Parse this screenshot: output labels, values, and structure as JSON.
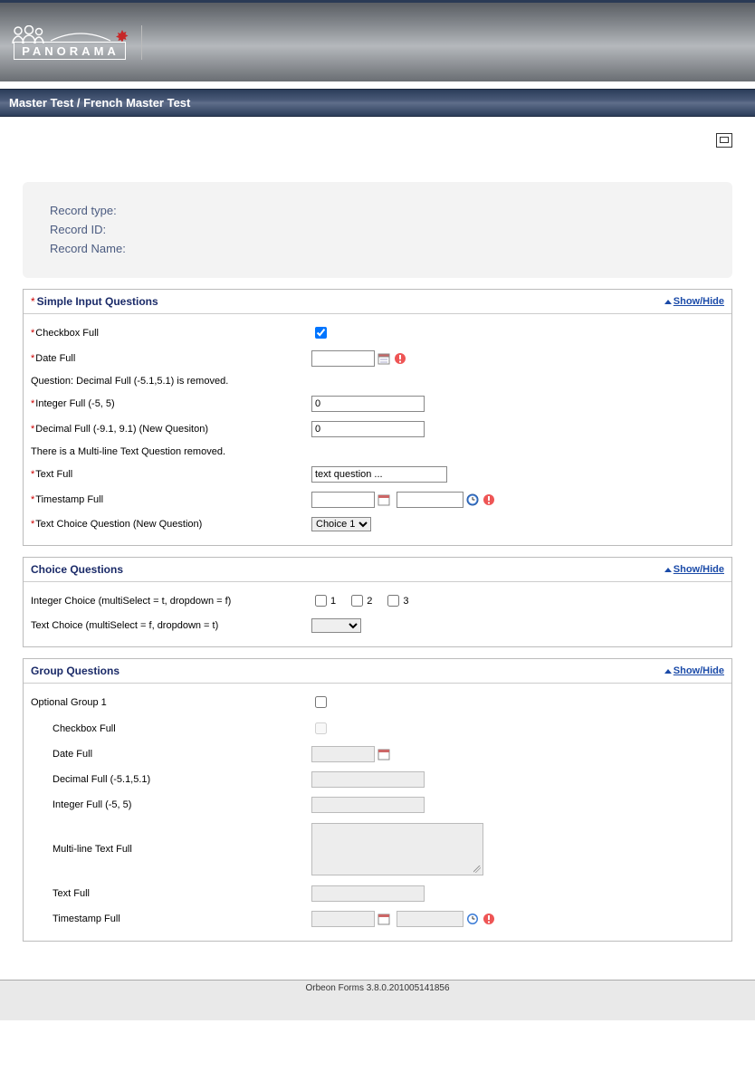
{
  "breadcrumb": "Master Test / French Master Test",
  "logo_text": "PANORAMA",
  "record": {
    "type_label": "Record type:",
    "id_label": "Record ID:",
    "name_label": "Record Name:"
  },
  "showhide_label": "Show/Hide",
  "sections": {
    "simple": {
      "title": "Simple Input Questions",
      "required": true,
      "checkbox_label": "Checkbox Full",
      "date_label": "Date Full",
      "removed_decimal_msg": "Question: Decimal Full (-5.1,5.1) is removed.",
      "integer_label": "Integer Full (-5, 5)",
      "integer_value": "0",
      "decimal_label": "Decimal Full (-9.1, 9.1) (New Quesiton)",
      "decimal_value": "0",
      "removed_multiline_msg": "There is a Multi-line Text Question removed.",
      "text_label": "Text Full",
      "text_value": "text question ...",
      "timestamp_label": "Timestamp Full",
      "textchoice_label": "Text Choice Question (New Question)",
      "textchoice_value": "Choice 1"
    },
    "choice": {
      "title": "Choice Questions",
      "intchoice_label": "Integer Choice (multiSelect = t, dropdown = f)",
      "intchoice_opts": [
        "1",
        "2",
        "3"
      ],
      "textchoice_label": "Text Choice (multiSelect = f, dropdown = t)"
    },
    "group": {
      "title": "Group Questions",
      "optgroup_label": "Optional Group 1",
      "checkbox_label": "Checkbox Full",
      "date_label": "Date Full",
      "decimal_label": "Decimal Full (-5.1,5.1)",
      "integer_label": "Integer Full (-5, 5)",
      "multiline_label": "Multi-line Text Full",
      "text_label": "Text Full",
      "timestamp_label": "Timestamp Full"
    }
  },
  "footer": "Orbeon Forms 3.8.0.201005141856"
}
